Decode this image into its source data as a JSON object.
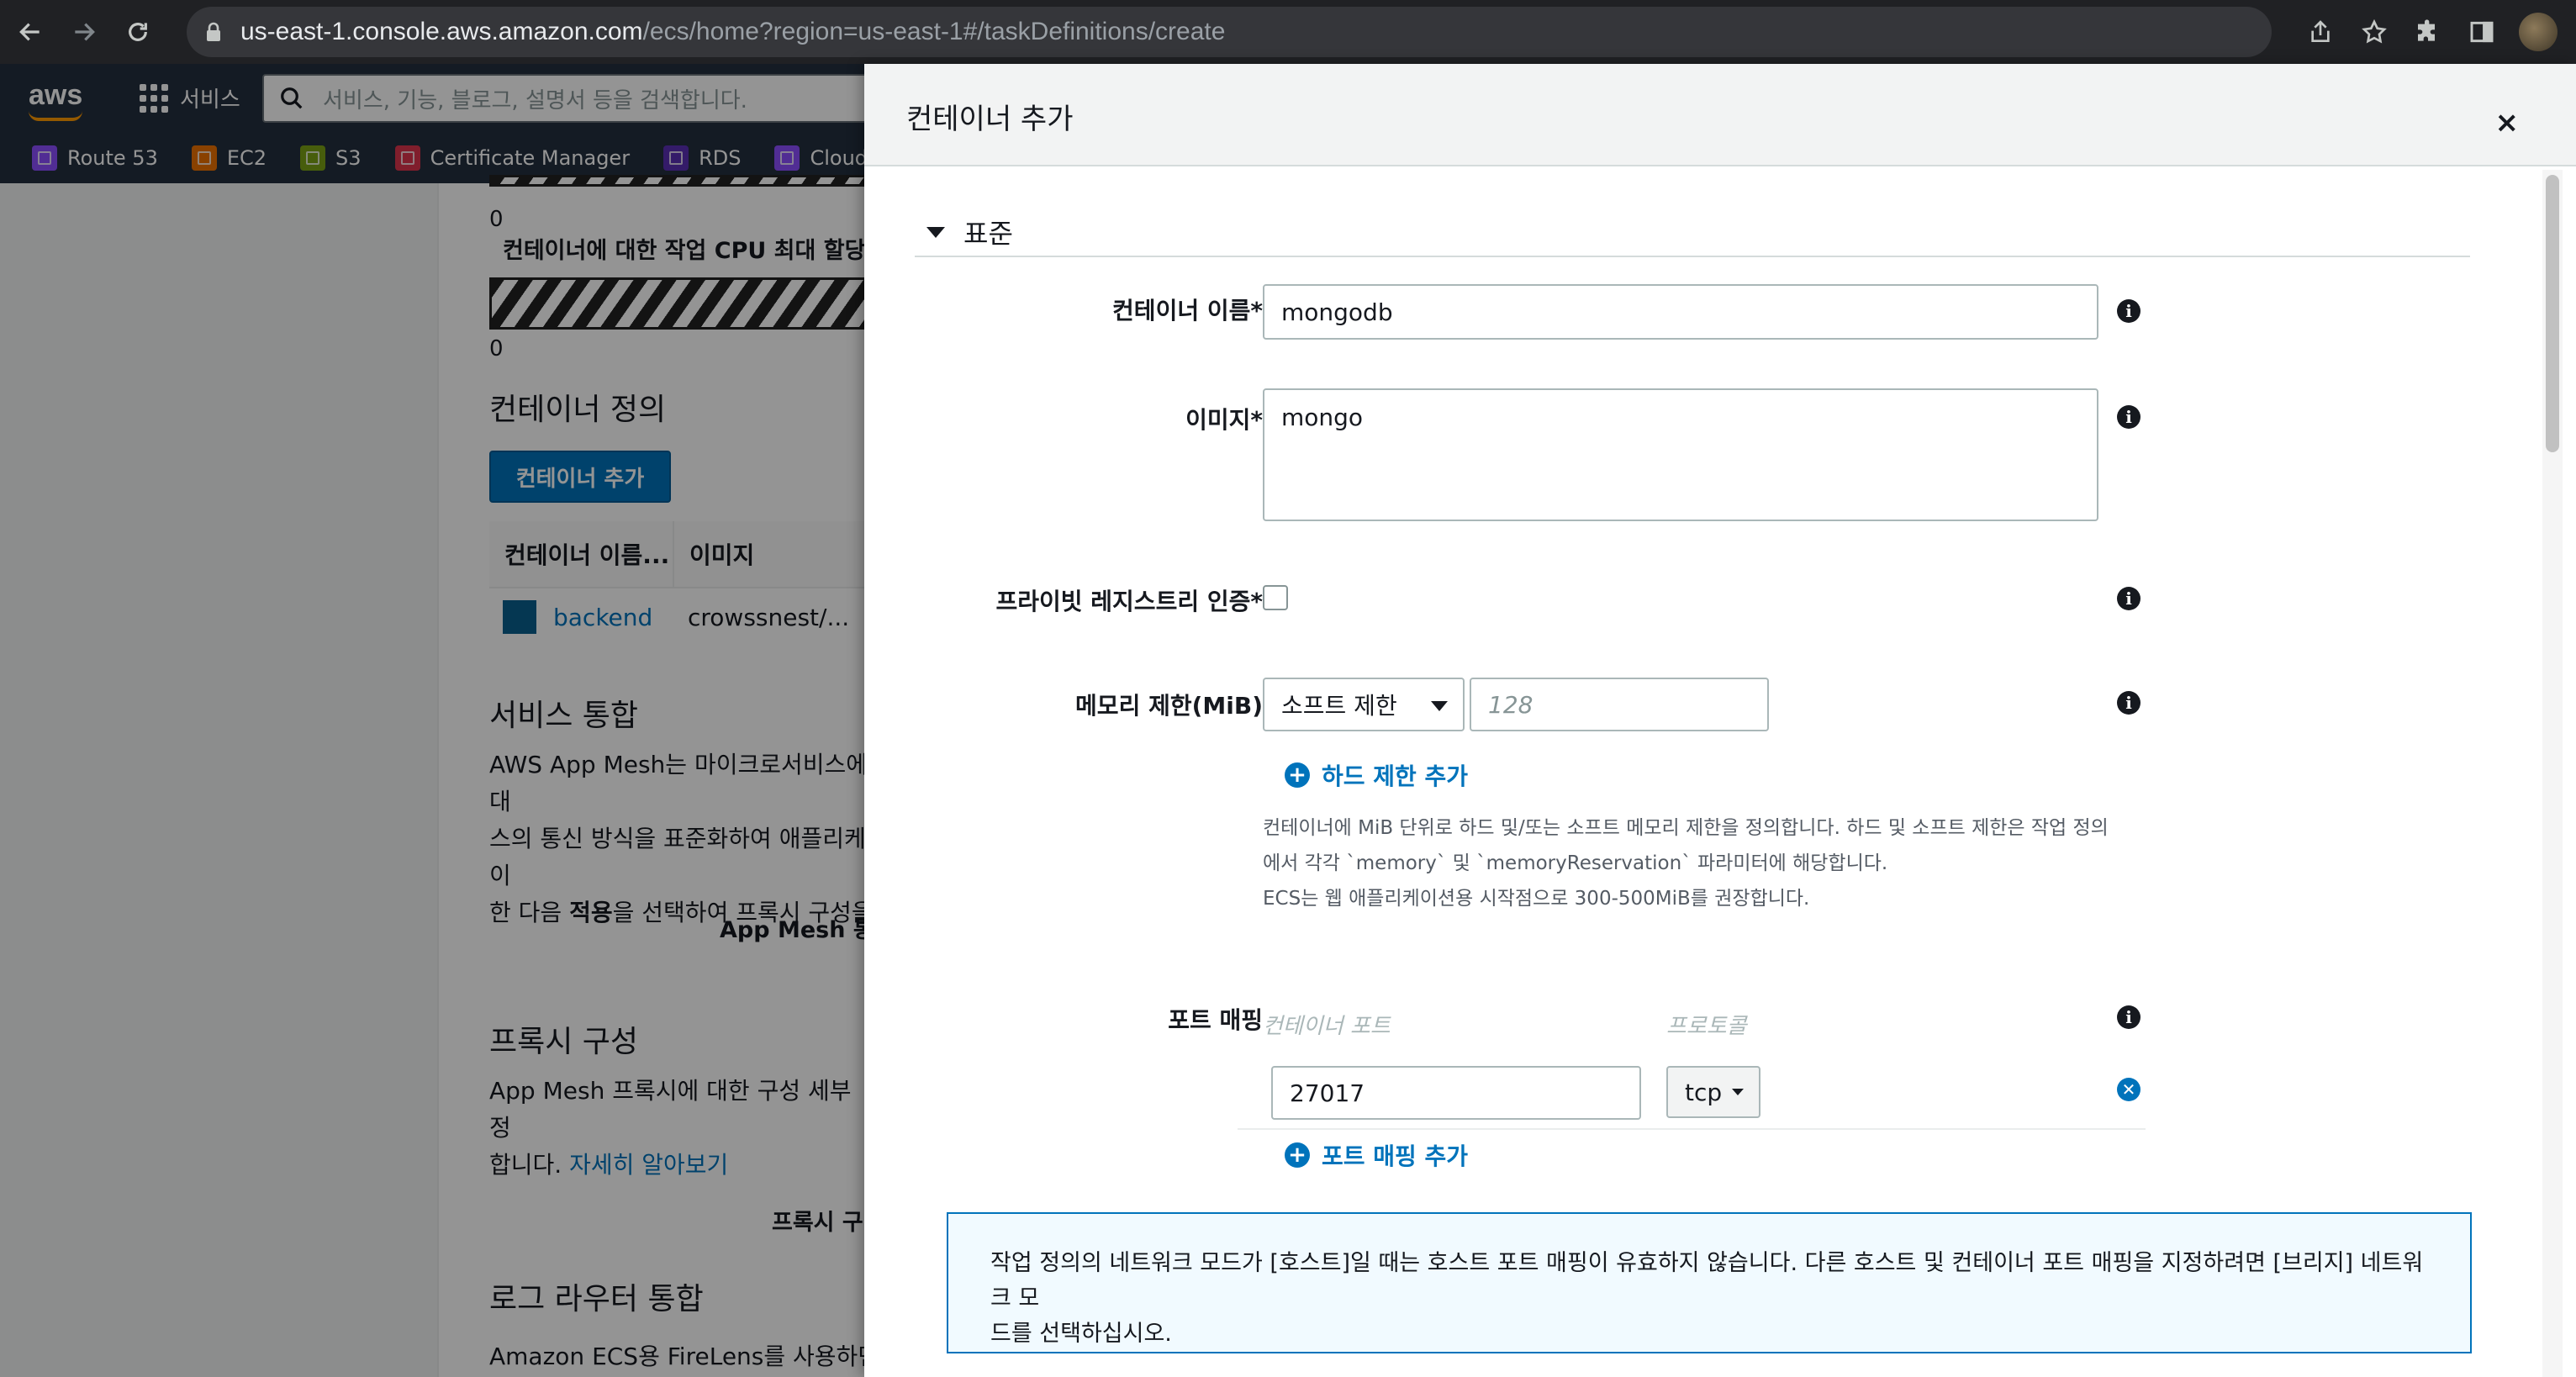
{
  "browser": {
    "url_host": "us-east-1.console.aws.amazon.com",
    "url_path": "/ecs/home?region=us-east-1#/taskDefinitions/create"
  },
  "aws_nav": {
    "logo": "aws",
    "services_label": "서비스",
    "search_placeholder": "서비스, 기능, 블로그, 설명서 등을 검색합니다."
  },
  "favorites": [
    {
      "label": "Route 53",
      "color": "#8c4fff"
    },
    {
      "label": "EC2",
      "color": "#ed7100"
    },
    {
      "label": "S3",
      "color": "#7aa116"
    },
    {
      "label": "Certificate Manager",
      "color": "#dd344c"
    },
    {
      "label": "RDS",
      "color": "#5a30b5"
    },
    {
      "label": "CloudFront",
      "color": "#8c4fff"
    }
  ],
  "background": {
    "zero_1": "0",
    "cpu_label": "컨테이너에 대한 작업 CPU 최대 할당",
    "zero_2": "0",
    "container_def_heading": "컨테이너 정의",
    "add_container_button": "컨테이너 추가",
    "table_headers": [
      "컨테이너 이름...",
      "이미지"
    ],
    "row_name": "backend",
    "row_image": "crowssnest/...",
    "service_integration_heading": "서비스 통합",
    "service_integration_line1": "AWS App Mesh는 마이크로서비스에 대",
    "service_integration_line2": "스의 통신 방식을 표준화하여 애플리케이",
    "service_integration_line3_pre": "한 다음 ",
    "service_integration_line3_bold": "적용",
    "service_integration_line3_post": "을 선택하여 프록시 구성을 ",
    "app_mesh_label": "App Mesh 통",
    "proxy_heading": "프록시 구성",
    "proxy_line1": "App Mesh 프록시에 대한 구성 세부 정",
    "proxy_line2_pre": "합니다. ",
    "proxy_line2_link": "자세히 알아보기",
    "proxy_label": "프록시 구",
    "log_router_heading": "로그 라우터 통합",
    "log_router_line1": "Amazon ECS용 FireLens를 사용하면"
  },
  "modal": {
    "title": "컨테이너 추가",
    "close": "×",
    "section": "표준",
    "container_name_label": "컨테이너 이름*",
    "container_name_value": "mongodb",
    "image_label": "이미지*",
    "image_value": "mongo",
    "private_registry_label": "프라이빗 레지스트리 인증*",
    "memory_label": "메모리 제한(MiB)",
    "memory_select": "소프트 제한",
    "memory_placeholder": "128",
    "add_hard_limit": "하드 제한 추가",
    "help_line1": "컨테이너에 MiB 단위로 하드 및/또는 소프트 메모리 제한을 정의합니다. 하드 및 소프트 제한은 작업 정의",
    "help_line2": "에서 각각 `memory` 및 `memoryReservation` 파라미터에 해당합니다.",
    "help_line3": "ECS는 웹 애플리케이션용 시작점으로 300-500MiB를 권장합니다.",
    "port_mapping_label": "포트 매핑",
    "col_container_port": "컨테이너 포트",
    "col_protocol": "프로토콜",
    "port_value": "27017",
    "protocol_value": "tcp",
    "add_port_mapping": "포트 매핑 추가",
    "alert_line1": "작업 정의의 네트워크 모드가 [호스트]일 때는 호스트 포트 매핑이 유효하지 않습니다. 다른 호스트 및 컨테이너 포트 매핑을 지정하려면 [브리지] 네트워크 모",
    "alert_line2": "드를 선택하십시오."
  }
}
